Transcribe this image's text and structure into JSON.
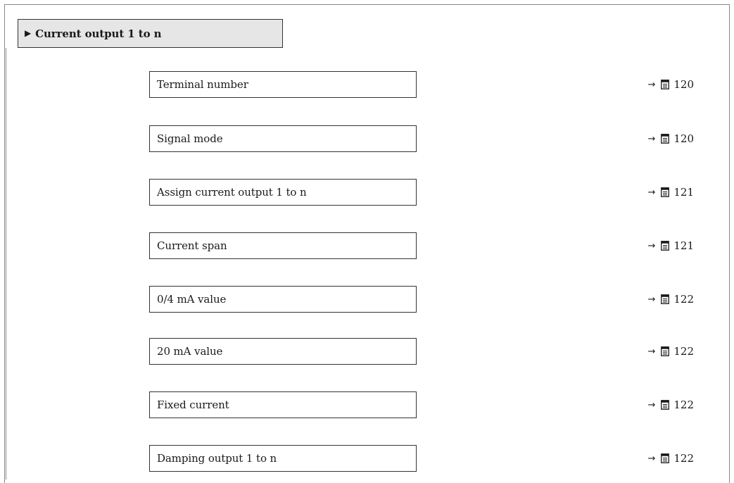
{
  "header": {
    "arrow_icon": "right-triangle",
    "title": "Current output 1 to n"
  },
  "parameters": [
    {
      "label": "Terminal number",
      "ref_arrow": "→",
      "page": "120"
    },
    {
      "label": "Signal mode",
      "ref_arrow": "→",
      "page": "120"
    },
    {
      "label": "Assign current output 1 to n",
      "ref_arrow": "→",
      "page": "121"
    },
    {
      "label": "Current span",
      "ref_arrow": "→",
      "page": "121"
    },
    {
      "label": "0/4 mA value",
      "ref_arrow": "→",
      "page": "122"
    },
    {
      "label": "20 mA value",
      "ref_arrow": "→",
      "page": "122"
    },
    {
      "label": "Fixed current",
      "ref_arrow": "→",
      "page": "122"
    },
    {
      "label": "Damping output 1 to n",
      "ref_arrow": "→",
      "page": "122"
    }
  ],
  "icons": {
    "page_reference": "book-icon"
  }
}
